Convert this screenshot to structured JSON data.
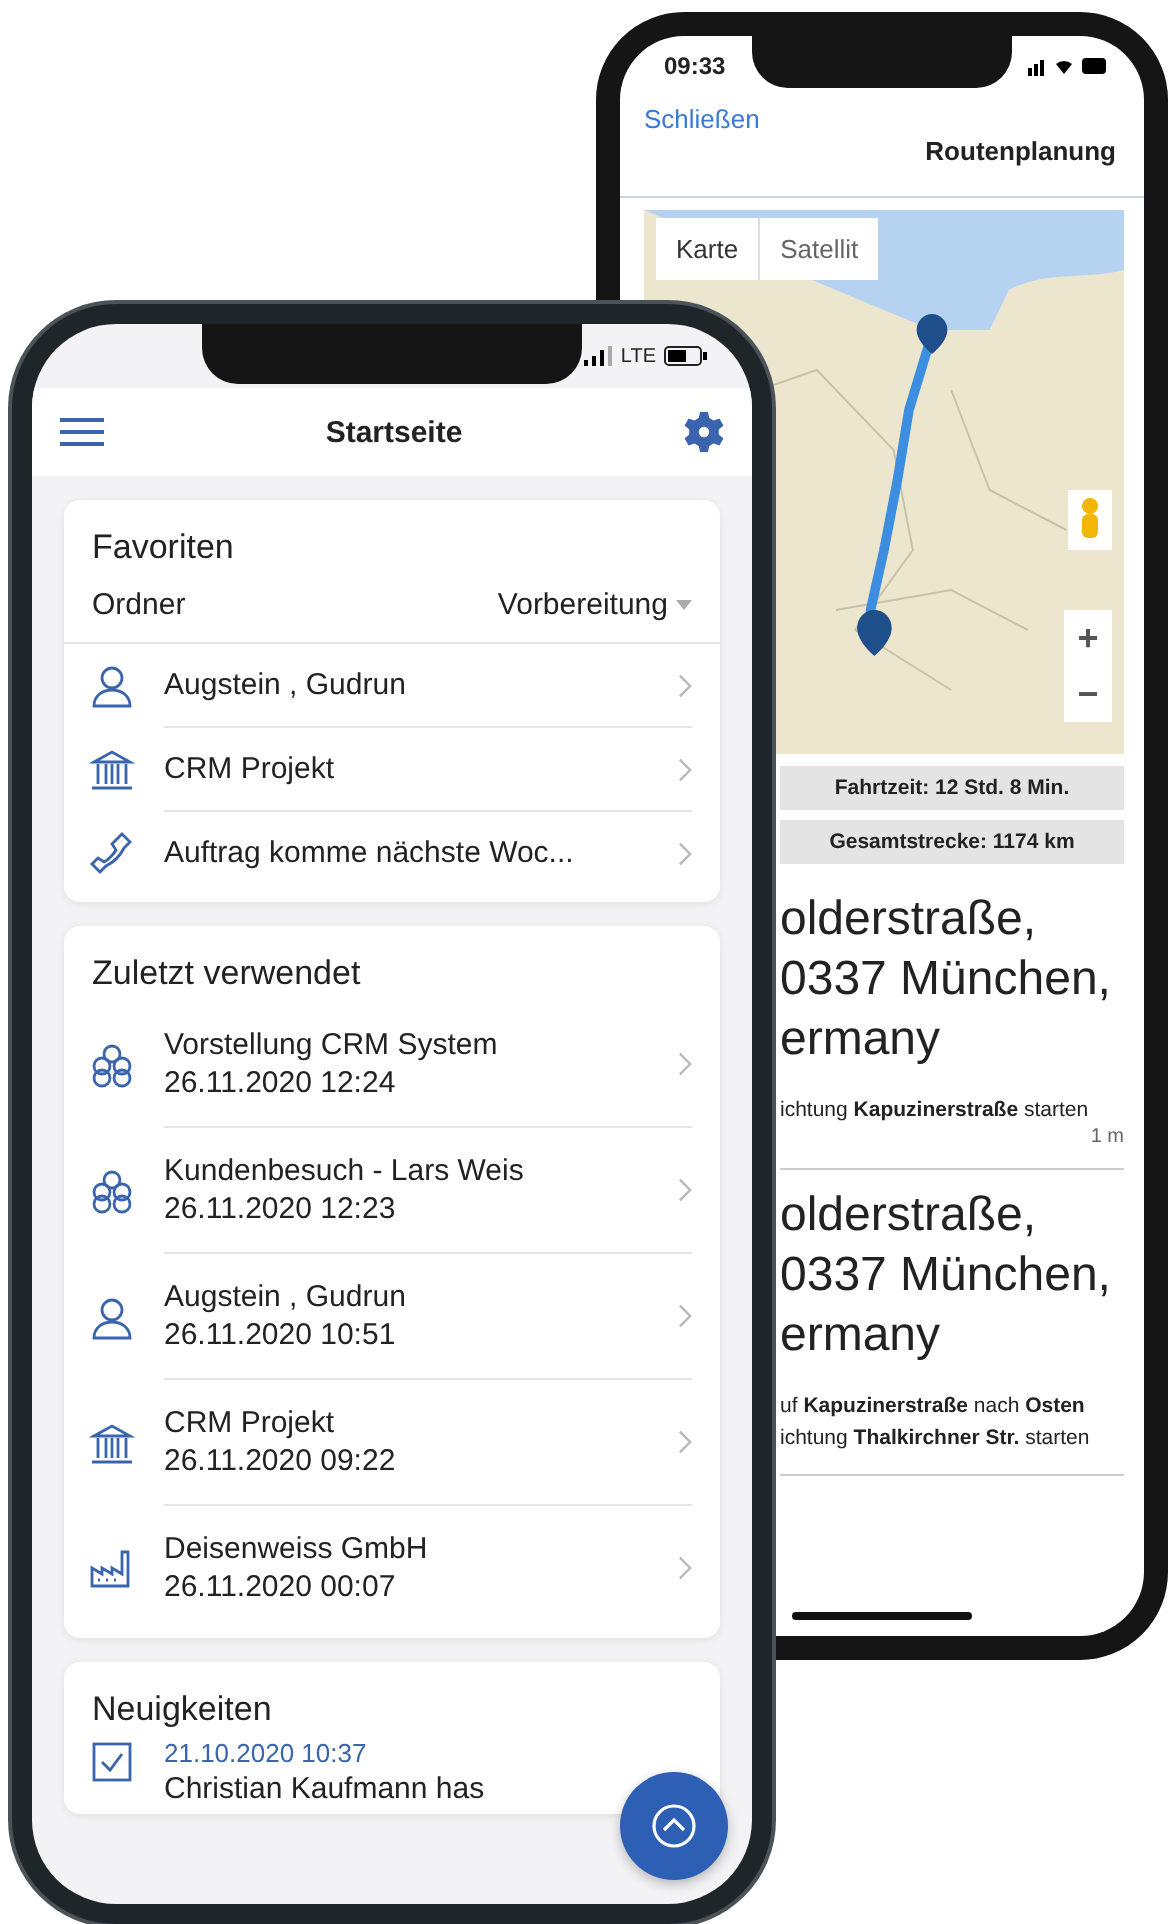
{
  "back_phone": {
    "status_time": "09:33",
    "nav": {
      "close": "Schließen",
      "title": "Routenplanung"
    },
    "map": {
      "tabs": [
        "Karte",
        "Satellit"
      ],
      "zoom_in": "+",
      "zoom_out": "−"
    },
    "summary": [
      "Fahrtzeit: 12 Std. 8 Min.",
      "Gesamtstrecke: 1174 km"
    ],
    "steps": [
      {
        "address_lines": [
          "olderstraße,",
          "0337 München,",
          "ermany"
        ],
        "instructions": [
          "ichtung **Kapuzinerstraße** starten"
        ],
        "distance": "1 m"
      },
      {
        "address_lines": [
          "olderstraße,",
          "0337 München,",
          "ermany"
        ],
        "instructions": [
          "uf **Kapuzinerstraße** nach **Osten**",
          "ichtung **Thalkirchner Str.** starten"
        ]
      }
    ]
  },
  "front_phone": {
    "status": {
      "network": "LTE"
    },
    "header": {
      "title": "Startseite"
    },
    "favorites": {
      "title": "Favoriten",
      "folder_label": "Ordner",
      "folder_value": "Vorbereitung",
      "items": [
        {
          "kind": "person",
          "label": "Augstein , Gudrun"
        },
        {
          "kind": "project",
          "label": "CRM Projekt"
        },
        {
          "kind": "call",
          "label": "Auftrag komme nächste Woc..."
        }
      ]
    },
    "recent": {
      "title": "Zuletzt verwendet",
      "items": [
        {
          "kind": "meeting",
          "label": "Vorstellung CRM System",
          "date": "26.11.2020 12:24"
        },
        {
          "kind": "meeting",
          "label": "Kundenbesuch - Lars Weis",
          "date": "26.11.2020 12:23"
        },
        {
          "kind": "person",
          "label": "Augstein , Gudrun",
          "date": "26.11.2020 10:51"
        },
        {
          "kind": "project",
          "label": "CRM Projekt",
          "date": "26.11.2020 09:22"
        },
        {
          "kind": "company",
          "label": "Deisenweiss GmbH",
          "date": "26.11.2020 00:07"
        }
      ]
    },
    "news": {
      "title": "Neuigkeiten",
      "items": [
        {
          "kind": "task",
          "date": "21.10.2020 10:37",
          "text": "Christian Kaufmann has"
        }
      ]
    }
  }
}
